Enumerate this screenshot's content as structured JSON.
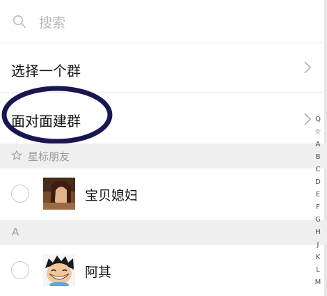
{
  "search": {
    "placeholder": "搜索",
    "icon": "search-icon"
  },
  "menu": [
    {
      "label": "选择一个群"
    },
    {
      "label": "面对面建群"
    }
  ],
  "sections": [
    {
      "title": "星标朋友",
      "icon": "star-icon"
    },
    {
      "title": "A"
    }
  ],
  "contacts": [
    {
      "name": "宝贝媳妇"
    },
    {
      "name": "阿其"
    }
  ],
  "index_bar": [
    "Q",
    "☆",
    "A",
    "B",
    "C",
    "D",
    "E",
    "F",
    "G",
    "H",
    "J",
    "K",
    "L",
    "M"
  ],
  "colors": {
    "annotation": "#1a1750",
    "section_bg": "#efefef",
    "muted_text": "#9a9a9a"
  }
}
